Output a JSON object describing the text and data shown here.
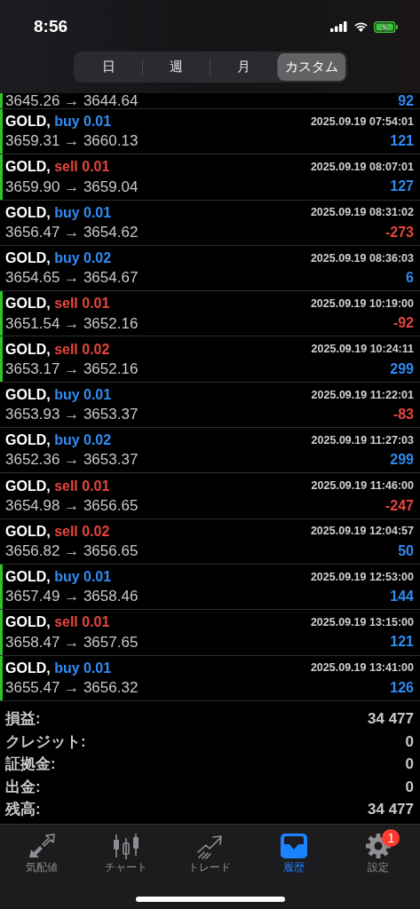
{
  "status_bar": {
    "time": "8:56"
  },
  "period_tabs": [
    {
      "label": "日",
      "selected": false
    },
    {
      "label": "週",
      "selected": false
    },
    {
      "label": "月",
      "selected": false
    },
    {
      "label": "カスタム",
      "selected": true
    }
  ],
  "cut_row": {
    "prices": "3645.26 → 3644.64",
    "profit": "92",
    "loss": false,
    "marked": true
  },
  "deals": [
    {
      "symbol": "GOLD,",
      "side": "buy",
      "lots": "0.01",
      "time": "2025.09.19 07:54:01",
      "prices": "3659.31 → 3660.13",
      "profit": "121",
      "loss": false,
      "marked": true
    },
    {
      "symbol": "GOLD,",
      "side": "sell",
      "lots": "0.01",
      "time": "2025.09.19 08:07:01",
      "prices": "3659.90 → 3659.04",
      "profit": "127",
      "loss": false,
      "marked": true
    },
    {
      "symbol": "GOLD,",
      "side": "buy",
      "lots": "0.01",
      "time": "2025.09.19 08:31:02",
      "prices": "3656.47 → 3654.62",
      "profit": "-273",
      "loss": true,
      "marked": false
    },
    {
      "symbol": "GOLD,",
      "side": "buy",
      "lots": "0.02",
      "time": "2025.09.19 08:36:03",
      "prices": "3654.65 → 3654.67",
      "profit": "6",
      "loss": false,
      "marked": false
    },
    {
      "symbol": "GOLD,",
      "side": "sell",
      "lots": "0.01",
      "time": "2025.09.19 10:19:00",
      "prices": "3651.54 → 3652.16",
      "profit": "-92",
      "loss": true,
      "marked": true
    },
    {
      "symbol": "GOLD,",
      "side": "sell",
      "lots": "0.02",
      "time": "2025.09.19 10:24:11",
      "prices": "3653.17 → 3652.16",
      "profit": "299",
      "loss": false,
      "marked": true
    },
    {
      "symbol": "GOLD,",
      "side": "buy",
      "lots": "0.01",
      "time": "2025.09.19 11:22:01",
      "prices": "3653.93 → 3653.37",
      "profit": "-83",
      "loss": true,
      "marked": false
    },
    {
      "symbol": "GOLD,",
      "side": "buy",
      "lots": "0.02",
      "time": "2025.09.19 11:27:03",
      "prices": "3652.36 → 3653.37",
      "profit": "299",
      "loss": false,
      "marked": false
    },
    {
      "symbol": "GOLD,",
      "side": "sell",
      "lots": "0.01",
      "time": "2025.09.19 11:46:00",
      "prices": "3654.98 → 3656.65",
      "profit": "-247",
      "loss": true,
      "marked": false
    },
    {
      "symbol": "GOLD,",
      "side": "sell",
      "lots": "0.02",
      "time": "2025.09.19 12:04:57",
      "prices": "3656.82 → 3656.65",
      "profit": "50",
      "loss": false,
      "marked": false
    },
    {
      "symbol": "GOLD,",
      "side": "buy",
      "lots": "0.01",
      "time": "2025.09.19 12:53:00",
      "prices": "3657.49 → 3658.46",
      "profit": "144",
      "loss": false,
      "marked": true
    },
    {
      "symbol": "GOLD,",
      "side": "sell",
      "lots": "0.01",
      "time": "2025.09.19 13:15:00",
      "prices": "3658.47 → 3657.65",
      "profit": "121",
      "loss": false,
      "marked": true
    },
    {
      "symbol": "GOLD,",
      "side": "buy",
      "lots": "0.01",
      "time": "2025.09.19 13:41:00",
      "prices": "3655.47 → 3656.32",
      "profit": "126",
      "loss": false,
      "marked": true
    }
  ],
  "summary": [
    {
      "label": "損益:",
      "value": "34 477"
    },
    {
      "label": "クレジット:",
      "value": "0"
    },
    {
      "label": "証拠金:",
      "value": "0"
    },
    {
      "label": "出金:",
      "value": "0"
    },
    {
      "label": "残高:",
      "value": "34 477"
    }
  ],
  "bottom_tabs": [
    {
      "kind": "quotes",
      "label": "気配値",
      "selected": false
    },
    {
      "kind": "chart",
      "label": "チャート",
      "selected": false
    },
    {
      "kind": "trade",
      "label": "トレード",
      "selected": false
    },
    {
      "kind": "history",
      "label": "履歴",
      "selected": true
    },
    {
      "kind": "settings",
      "label": "設定",
      "selected": false,
      "badge": "1"
    }
  ]
}
